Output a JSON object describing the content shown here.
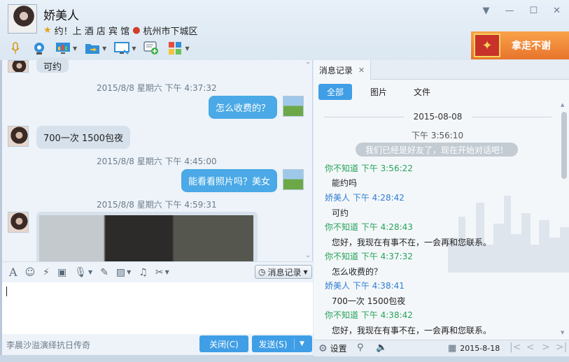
{
  "header": {
    "name": "娇美人",
    "status": "约！上 酒 店 宾 馆",
    "location": "杭州市下城区",
    "promo_label": "拿走不谢",
    "window_controls": [
      "▼",
      "—",
      "☐",
      "✕"
    ]
  },
  "toolbar": {
    "icons": [
      "microphone-icon",
      "video-icon",
      "screen-share-icon",
      "file-transfer-icon",
      "remote-desktop-icon",
      "add-app-icon",
      "apps-icon"
    ]
  },
  "chat": {
    "top_partial": "可约",
    "ts1": "2015/8/8 星期六 下午 4:37:32",
    "out1": "怎么收费的？",
    "in1": "700一次 1500包夜",
    "ts2": "2015/8/8 星期六 下午 4:45:00",
    "out2": "能看看照片吗？美女",
    "ts3": "2015/8/8 星期六 下午 4:59:31"
  },
  "input": {
    "history_label": "消息记录",
    "marquee": "李晨沙溢演绎抗日传奇",
    "close_label": "关闭(C)",
    "send_label": "发送(S)"
  },
  "panel": {
    "tab_label": "消息记录",
    "filters": [
      "全部",
      "图片",
      "文件"
    ],
    "date": "2015-08-08",
    "sys_time": "下午 3:56:10",
    "sys_msg": "我们已经是好友了，现在开始对话吧！",
    "entries": [
      {
        "sender": "你不知道 下午 3:56:22",
        "kind": "other",
        "text": "能约吗"
      },
      {
        "sender": "娇美人  下午 4:28:42",
        "kind": "self",
        "text": "可约"
      },
      {
        "sender": "你不知道 下午 4:28:43",
        "kind": "other",
        "text": "您好，我现在有事不在，一会再和您联系。"
      },
      {
        "sender": "你不知道 下午 4:37:32",
        "kind": "other",
        "text": "怎么收费的？"
      },
      {
        "sender": "娇美人  下午 4:38:41",
        "kind": "self",
        "text": "700一次 1500包夜"
      },
      {
        "sender": "你不知道 下午 4:38:42",
        "kind": "other",
        "text": "您好，我现在有事不在，一会再和您联系。"
      }
    ],
    "settings_label": "设置",
    "date_value": "2015-8-18"
  },
  "colors": {
    "accent": "#3f9ee6",
    "bubble_out": "#4aa9e6",
    "sender_other": "#25a35a",
    "sender_self": "#2e7ed2"
  }
}
